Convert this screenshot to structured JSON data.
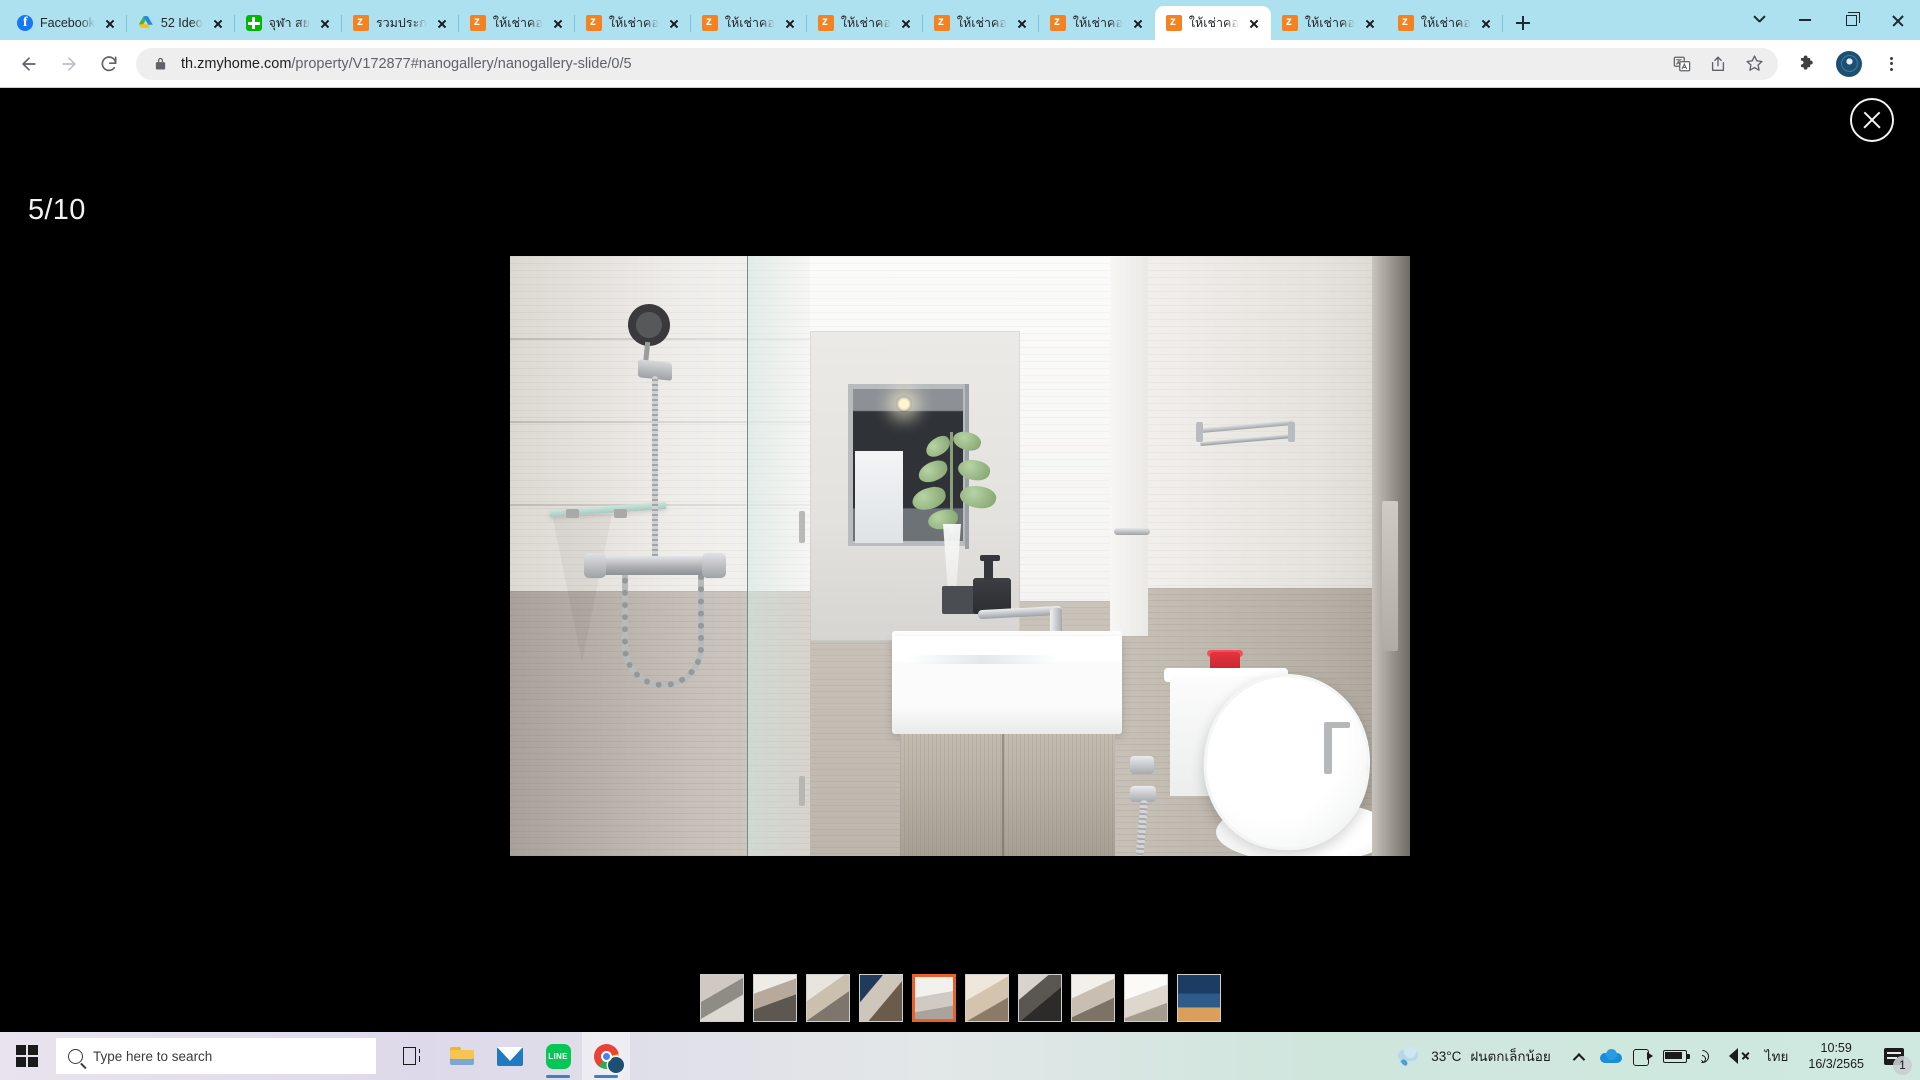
{
  "browser": {
    "tabs": [
      {
        "title": "Facebook",
        "favicon": "facebook-icon",
        "active": false
      },
      {
        "title": "52 Ideo",
        "favicon": "google-drive-icon",
        "active": false
      },
      {
        "title": "จุฬา สย",
        "favicon": "line-green-icon",
        "active": false
      },
      {
        "title": "รวมประก",
        "favicon": "zmyhome-icon",
        "active": false
      },
      {
        "title": "ให้เช่าคอ",
        "favicon": "zmyhome-icon",
        "active": false
      },
      {
        "title": "ให้เช่าคอ",
        "favicon": "zmyhome-icon",
        "active": false
      },
      {
        "title": "ให้เช่าคอ",
        "favicon": "zmyhome-icon",
        "active": false
      },
      {
        "title": "ให้เช่าคอ",
        "favicon": "zmyhome-icon",
        "active": false
      },
      {
        "title": "ให้เช่าคอ",
        "favicon": "zmyhome-icon",
        "active": false
      },
      {
        "title": "ให้เช่าคอ",
        "favicon": "zmyhome-icon",
        "active": false
      },
      {
        "title": "ให้เช่าคอ",
        "favicon": "zmyhome-icon",
        "active": true
      },
      {
        "title": "ให้เช่าคอ",
        "favicon": "zmyhome-icon",
        "active": false
      },
      {
        "title": "ให้เช่าคอ",
        "favicon": "zmyhome-icon",
        "active": false
      }
    ],
    "new_tab_label": "+",
    "window_controls": {
      "tab_search": "tab-search-chevron",
      "minimize": "minimize",
      "maximize": "maximize",
      "close": "close"
    },
    "toolbar": {
      "back": "Back",
      "forward": "Forward",
      "reload": "Reload",
      "lock_icon": "lock-icon",
      "url_host": "th.zmyhome.com",
      "url_path": "/property/V172877#nanogallery/nanogallery-slide/0/5",
      "url_full": "th.zmyhome.com/property/V172877#nanogallery/nanogallery-slide/0/5",
      "translate_icon": "translate-icon",
      "share_icon": "share-icon",
      "bookmark_icon": "star-icon",
      "extensions_icon": "puzzle-icon",
      "profile_icon": "profile-avatar",
      "menu_icon": "kebab-menu-icon"
    }
  },
  "lightbox": {
    "counter": "5/10",
    "close_label": "close-lightbox",
    "current_index": 5,
    "total": 10,
    "image_alt": "Modern bathroom with glass shower partition, wall-mounted shower set, white rectangular vessel sink on wood-grain vanity, large mirror and toilet with bidet sprayer",
    "thumbnails": [
      {
        "n": 1,
        "label": "living-room",
        "cls": "th-a",
        "active": false
      },
      {
        "n": 2,
        "label": "bedroom",
        "cls": "th-b",
        "active": false
      },
      {
        "n": 3,
        "label": "dining-kitchen",
        "cls": "th-c",
        "active": false
      },
      {
        "n": 4,
        "label": "bedroom-window",
        "cls": "th-d",
        "active": false
      },
      {
        "n": 5,
        "label": "bathroom",
        "cls": "th-e",
        "active": true
      },
      {
        "n": 6,
        "label": "hallway",
        "cls": "th-f",
        "active": false
      },
      {
        "n": 7,
        "label": "kitchen-counter",
        "cls": "th-g",
        "active": false
      },
      {
        "n": 8,
        "label": "laundry-corner",
        "cls": "th-h",
        "active": false
      },
      {
        "n": 9,
        "label": "kitchenette",
        "cls": "th-i",
        "active": false
      },
      {
        "n": 10,
        "label": "building-exterior",
        "cls": "th-j",
        "active": false
      }
    ]
  },
  "taskbar": {
    "start_label": "Start",
    "search_placeholder": "Type here to search",
    "search_value": "",
    "apps": [
      {
        "name": "task-view",
        "label": "Task View"
      },
      {
        "name": "file-explorer",
        "label": "File Explorer"
      },
      {
        "name": "mail",
        "label": "Mail"
      },
      {
        "name": "line",
        "label": "LINE"
      },
      {
        "name": "chrome",
        "label": "Google Chrome"
      }
    ],
    "line_badge": "LINE",
    "weather": {
      "temperature": "33°C",
      "condition": "ฝนตกเล็กน้อย",
      "icon": "rain-cloud-icon"
    },
    "tray": {
      "show_hidden": "show-hidden-icons",
      "onedrive": "onedrive-icon",
      "meet": "meet-now-icon",
      "battery": "battery-icon",
      "network": "wifi-icon",
      "volume": "speaker-muted-icon",
      "language": "ไทย"
    },
    "clock": {
      "time": "10:59",
      "date": "16/3/2565"
    },
    "notifications": {
      "icon": "notification-icon",
      "count": "1"
    }
  }
}
